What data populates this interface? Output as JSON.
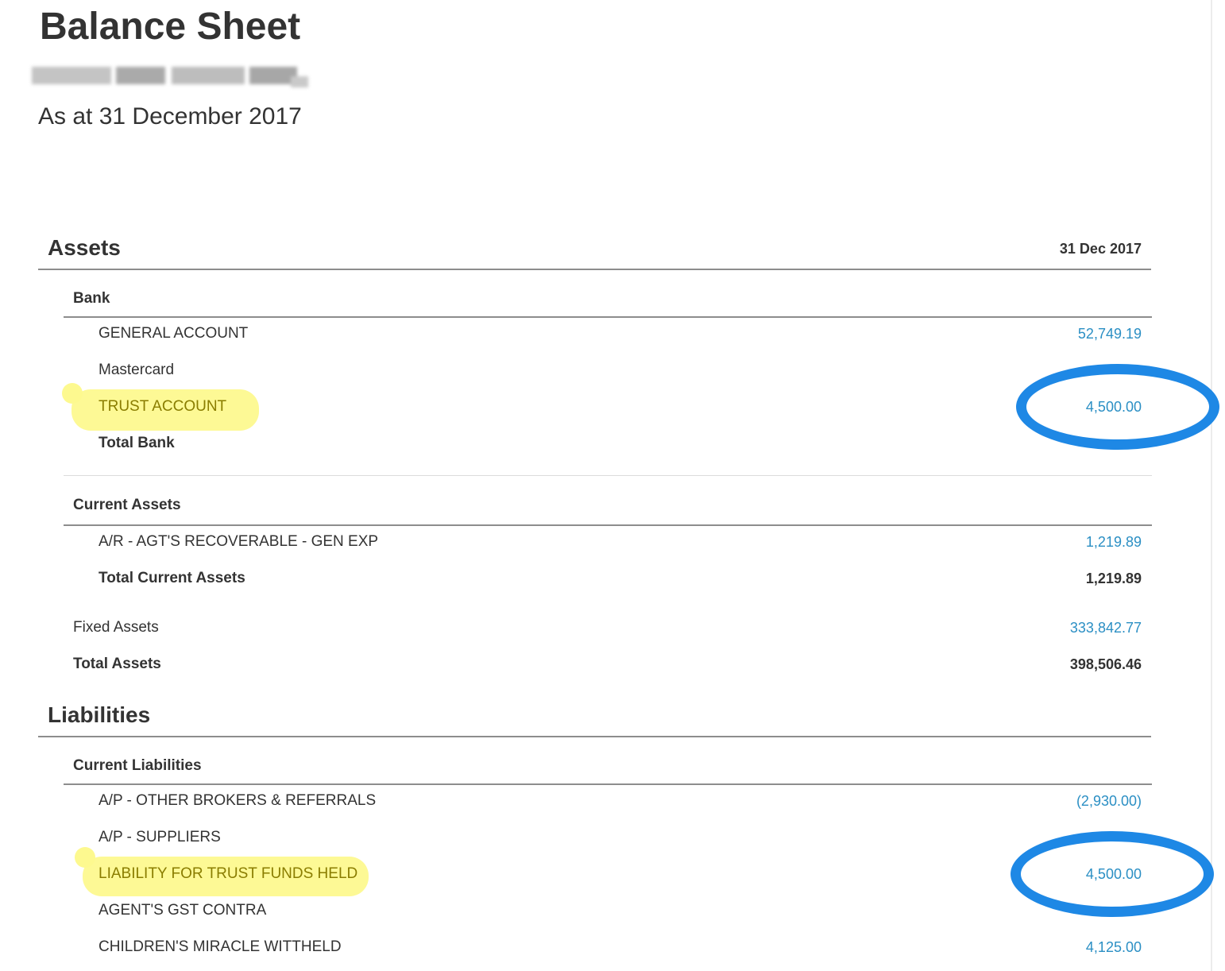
{
  "report": {
    "title": "Balance Sheet",
    "date_line": "As at 31 December 2017",
    "column_header": "31 Dec 2017"
  },
  "assets": {
    "heading": "Assets",
    "bank": {
      "heading": "Bank",
      "rows": [
        {
          "label": "GENERAL ACCOUNT",
          "value": "52,749.19"
        },
        {
          "label": "Mastercard",
          "value": ""
        },
        {
          "label": "TRUST ACCOUNT",
          "value": "4,500.00"
        }
      ],
      "total_label": "Total Bank",
      "total_value": ""
    },
    "current": {
      "heading": "Current Assets",
      "rows": [
        {
          "label": "A/R - AGT'S RECOVERABLE - GEN EXP",
          "value": "1,219.89"
        }
      ],
      "total_label": "Total Current Assets",
      "total_value": "1,219.89"
    },
    "fixed": {
      "label": "Fixed Assets",
      "value": "333,842.77"
    },
    "total": {
      "label": "Total Assets",
      "value": "398,506.46"
    }
  },
  "liabilities": {
    "heading": "Liabilities",
    "current": {
      "heading": "Current Liabilities",
      "rows": [
        {
          "label": "A/P - OTHER BROKERS & REFERRALS",
          "value": "(2,930.00)"
        },
        {
          "label": "A/P - SUPPLIERS",
          "value": ""
        },
        {
          "label": "LIABILITY FOR TRUST FUNDS HELD",
          "value": "4,500.00"
        },
        {
          "label": "AGENT'S GST CONTRA",
          "value": ""
        },
        {
          "label": "CHILDREN'S MIRACLE WITTHELD",
          "value": "4,125.00"
        }
      ]
    }
  },
  "annotations": {
    "highlight_color": "#fdf98f",
    "circle_color": "#1e88e5",
    "link_color": "#2b8fc4"
  }
}
